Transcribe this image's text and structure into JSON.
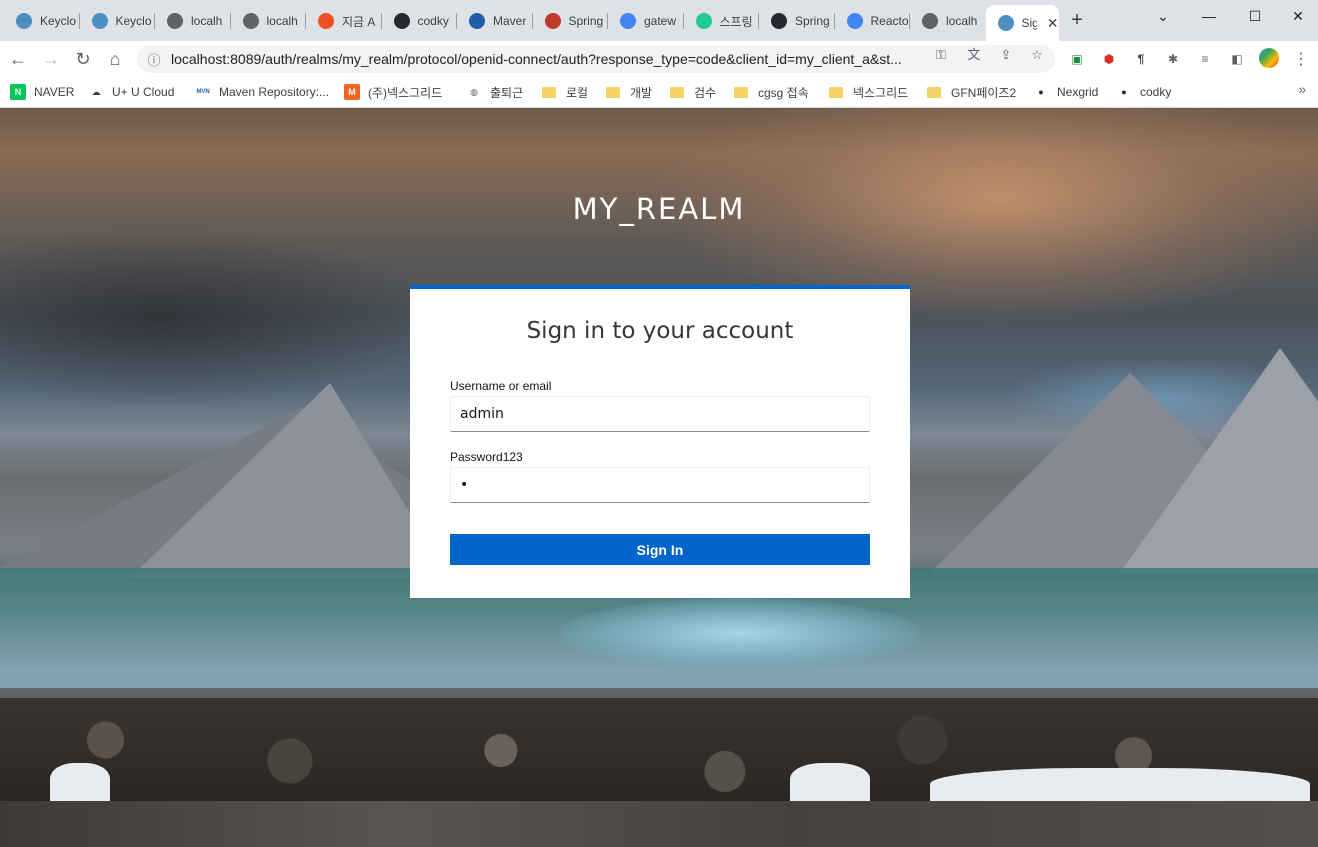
{
  "browser": {
    "tabs": [
      {
        "title": "Keyclo",
        "icon": "keycloak-icon",
        "color": "#4d8fc2"
      },
      {
        "title": "Keyclo",
        "icon": "keycloak-icon",
        "color": "#4d8fc2"
      },
      {
        "title": "localh",
        "icon": "globe-icon",
        "color": "#5f6368"
      },
      {
        "title": "localh",
        "icon": "globe-icon",
        "color": "#5f6368"
      },
      {
        "title": "지금 A",
        "icon": "microsoft-icon",
        "color": "#f25022"
      },
      {
        "title": "codky",
        "icon": "github-icon",
        "color": "#24292f"
      },
      {
        "title": "Maver",
        "icon": "maven-icon",
        "color": "#1f5fa8"
      },
      {
        "title": "Spring",
        "icon": "eyes-icon",
        "color": "#c0392b"
      },
      {
        "title": "gatew",
        "icon": "google-icon",
        "color": "#4285f4"
      },
      {
        "title": "스프링",
        "icon": "vuejs-icon",
        "color": "#20c997"
      },
      {
        "title": "Spring",
        "icon": "github-icon",
        "color": "#24292f"
      },
      {
        "title": "Reacto",
        "icon": "google-icon",
        "color": "#4285f4"
      },
      {
        "title": "localh",
        "icon": "globe-icon",
        "color": "#5f6368"
      },
      {
        "title": "Sig",
        "icon": "keycloak-icon",
        "color": "#4d8fc2",
        "active": true
      }
    ],
    "close_glyph": "✕",
    "new_tab_glyph": "+",
    "url": "localhost:8089/auth/realms/my_realm/protocol/openid-connect/auth?response_type=code&client_id=my_client_a&st...",
    "bookmarks": [
      {
        "label": "NAVER",
        "icon": "naver-icon"
      },
      {
        "label": "U+ U Cloud",
        "icon": "cloud-icon"
      },
      {
        "label": "Maven Repository:...",
        "icon": "maven-icon"
      },
      {
        "label": "(주)넥스그리드",
        "icon": "m-icon"
      },
      {
        "label": "출퇴근",
        "icon": "globe-icon"
      },
      {
        "label": "로컬",
        "icon": "folder-icon"
      },
      {
        "label": "개발",
        "icon": "folder-icon"
      },
      {
        "label": "검수",
        "icon": "folder-icon"
      },
      {
        "label": "cgsg 접속",
        "icon": "folder-icon"
      },
      {
        "label": "넥스그리드",
        "icon": "folder-icon"
      },
      {
        "label": "GFN페이즈2",
        "icon": "folder-icon"
      },
      {
        "label": "Nexgrid",
        "icon": "github-icon"
      },
      {
        "label": "codky",
        "icon": "github-icon"
      }
    ],
    "more_bookmarks_glyph": "»"
  },
  "page": {
    "realm_title": "MY_REALM",
    "card_title": "Sign in to your account",
    "username_label": "Username or email",
    "username_value": "admin",
    "password_label": "Password123",
    "password_value": "•",
    "sign_in_label": "Sign In"
  },
  "colors": {
    "accent": "#0066cc",
    "tabstrip": "#dee1e6"
  }
}
